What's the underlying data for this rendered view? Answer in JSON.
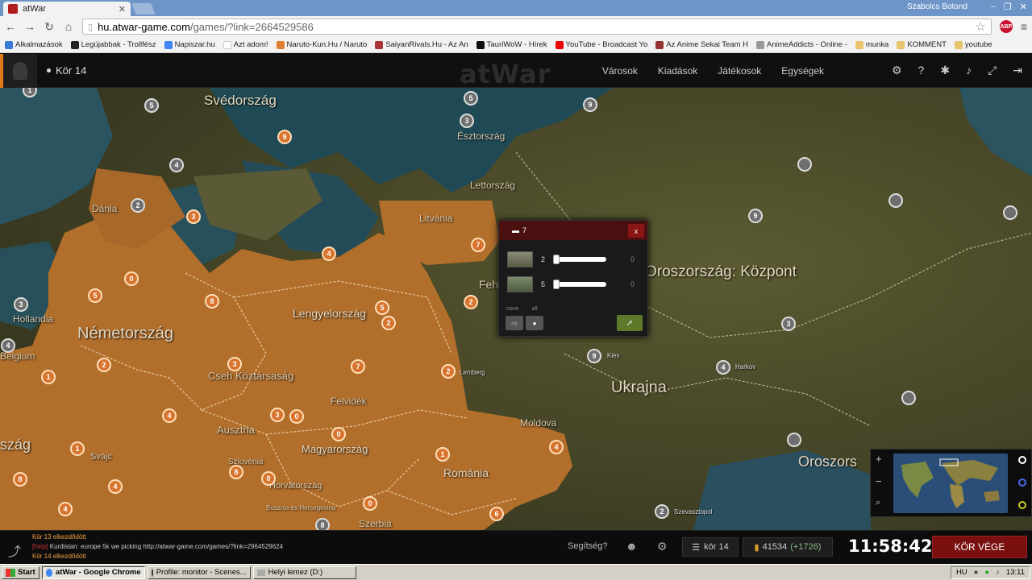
{
  "browser": {
    "tab_title": "atWar",
    "window_user": "Szabolcs Botond",
    "url_domain": "hu.atwar-game.com",
    "url_path": "/games/?link=2664529586"
  },
  "bookmarks": [
    "Alkalmazások",
    "Legújabbak - Trollfész",
    "Napiszar.hu",
    "Azt adom!",
    "Naruto-Kun.Hu / Naruto",
    "SaiyanRivals.Hu - Az An",
    "TauriWoW - Hírek",
    "YouTube - Broadcast Yo",
    "Az Anime Sekai Team H",
    "AnimeAddicts - Online -",
    "munka",
    "KOMMENT",
    "youtube"
  ],
  "game": {
    "turn_label": "Kör 14",
    "logo": "atWar",
    "nav": [
      "Városok",
      "Kiadások",
      "Játékosok",
      "Egységek"
    ]
  },
  "map": {
    "countries": {
      "svedorszag": "Svédország",
      "esztorszag": "Észtország",
      "lettorszag": "Lettország",
      "dania": "Dánia",
      "litvania": "Litvánia",
      "oroszorszag_kozpont": "Oroszország: Központ",
      "hollandia": "Hollandia",
      "nemetorszag": "Németország",
      "lengyelorszag": "Lengyelország",
      "feh": "Feh",
      "belgium": "Belgium",
      "csehkoztarsasag": "Cseh Köztársaság",
      "felvidek": "Felvidék",
      "ukrajna": "Ukrajna",
      "ausztria": "Ausztria",
      "moldova": "Moldova",
      "magyarorszag": "Magyarország",
      "romania": "Románia",
      "oroszors": "Oroszors",
      "szag": "szág",
      "svajc": "Svájc",
      "szlovenia": "Szlovénia",
      "horvatorszag": "Horvátország",
      "bosznia": "Bosznia és Hercegovina",
      "szerbia": "Szerbia"
    },
    "cities": {
      "kiev": "Kiev",
      "lemberg": "Lemberg",
      "harkov": "Harkov",
      "szevasztopol": "Szevasztopol"
    },
    "markers": {
      "m1": "1",
      "m2": "5",
      "m3": "9",
      "m4": "5",
      "m5": "3",
      "m6": "9",
      "m7": "4",
      "m8": "2",
      "m9": "3",
      "m10": "9",
      "m11": "7",
      "m12": "4",
      "m13": "0",
      "m14": "5",
      "m15": "8",
      "m16": "5",
      "m17": "2",
      "m18": "2",
      "m19": "3",
      "m20": "4",
      "m21": "1",
      "m22": "2",
      "m23": "3",
      "m24": "7",
      "m25": "2",
      "m26": "9",
      "m27": "4",
      "m28": "3",
      "m29": "4",
      "m30": "3",
      "m31": "0",
      "m32": "0",
      "m33": "1",
      "m34": "4",
      "m35": "1",
      "m36": "8",
      "m37": "4",
      "m38": "8",
      "m39": "0",
      "m40": "4",
      "m41": "0",
      "m42": "6",
      "m43": "8",
      "m44": "2"
    }
  },
  "unit_dialog": {
    "title_count": "7",
    "close": "x",
    "units": [
      {
        "index": "1",
        "count": "2",
        "selected": "0"
      },
      {
        "index": "2",
        "count": "5",
        "selected": "0"
      }
    ],
    "none_label": "none",
    "all_label": "all"
  },
  "bottom": {
    "log": [
      {
        "text": "Kör 13 elkezdődött",
        "kind": "turn"
      },
      {
        "tag": "[help]",
        "text": " Kurdistan: europe 5k we picking http://atwar-game.com/games/?link=2964529624",
        "kind": "chat"
      },
      {
        "text": "Kör 14 elkezdődött",
        "kind": "turn"
      }
    ],
    "help_label": "Segítség?",
    "turn_label": "kör 14",
    "gold": "41534",
    "gold_income": "(+1726)",
    "clock": "11:58:42",
    "end_turn": "KÖR VÉGE"
  },
  "taskbar": {
    "start": "Start",
    "items": [
      "atWar - Google Chrome",
      "Profile: monitor - Scenes...",
      "Helyi lemez (D:)"
    ],
    "lang": "HU",
    "time": "13:11"
  },
  "colors": {
    "owned_territory": "#b8732d",
    "neutral_land": "#4a4a2a",
    "end_turn_bg": "#7a0f0f",
    "accent": "#e07a1a"
  }
}
